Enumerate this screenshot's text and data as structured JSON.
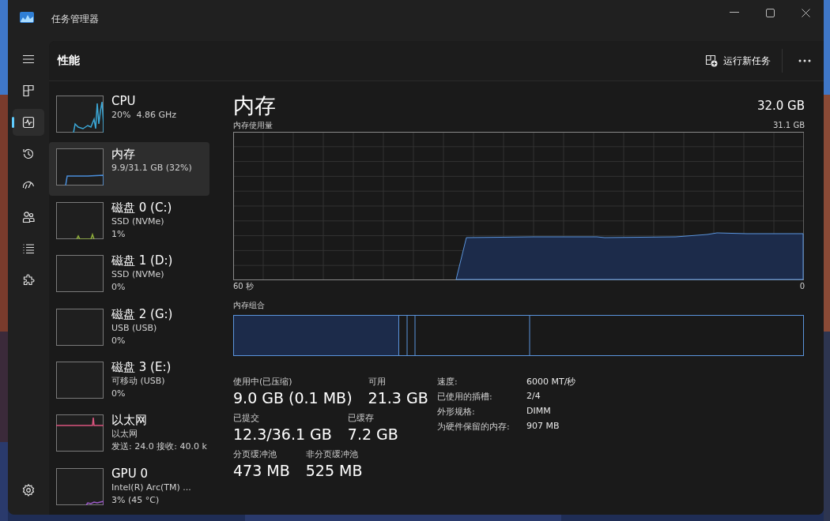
{
  "window": {
    "title": "任务管理器"
  },
  "nav_items": [
    {
      "kind": "menu",
      "selected": false
    },
    {
      "kind": "processes",
      "selected": false
    },
    {
      "kind": "performance",
      "selected": true
    },
    {
      "kind": "history",
      "selected": false
    },
    {
      "kind": "startup",
      "selected": false
    },
    {
      "kind": "users",
      "selected": false
    },
    {
      "kind": "details",
      "selected": false
    },
    {
      "kind": "services",
      "selected": false
    },
    {
      "kind": "settings",
      "selected": false
    }
  ],
  "page": {
    "title": "性能",
    "run_task": "运行新任务"
  },
  "devices": [
    {
      "kind": "cpu",
      "name": "CPU",
      "lines": [
        "20%  4.86 GHz"
      ],
      "color": "#3ba7d6",
      "selected": false
    },
    {
      "kind": "memory",
      "name": "内存",
      "lines": [
        "9.9/31.1 GB (32%)"
      ],
      "color": "#4a8fdc",
      "selected": true
    },
    {
      "kind": "disk_active",
      "name": "磁盘 0 (C:)",
      "lines": [
        "SSD (NVMe)",
        "1%"
      ],
      "color": "#8fae3a",
      "selected": false
    },
    {
      "kind": "disk",
      "name": "磁盘 1 (D:)",
      "lines": [
        "SSD (NVMe)",
        "0%"
      ],
      "selected": false
    },
    {
      "kind": "disk",
      "name": "磁盘 2 (G:)",
      "lines": [
        "USB (USB)",
        "0%"
      ],
      "selected": false
    },
    {
      "kind": "disk",
      "name": "磁盘 3 (E:)",
      "lines": [
        "可移动 (USB)",
        "0%"
      ],
      "selected": false
    },
    {
      "kind": "ethernet",
      "name": "以太网",
      "lines": [
        "以太网",
        "发送: 24.0 接收: 40.0 k"
      ],
      "color": "#d9547e",
      "selected": false
    },
    {
      "kind": "gpu",
      "name": "GPU 0",
      "lines": [
        "Intel(R) Arc(TM) ...",
        "3% (45 °C)"
      ],
      "color": "#9b59c6",
      "selected": false
    }
  ],
  "detail": {
    "title": "内存",
    "capacity": "32.0 GB",
    "usage_label": "内存使用量",
    "usage_max": "31.1 GB",
    "time_start": "60 秒",
    "time_end": "0",
    "composition_label": "内存组合",
    "stats": [
      [
        {
          "label": "使用中(已压缩)",
          "value": "9.0 GB (0.1 MB)"
        },
        {
          "label": "可用",
          "value": "21.3 GB"
        }
      ],
      [
        {
          "label": "已提交",
          "value": "12.3/36.1 GB"
        },
        {
          "label": "已缓存",
          "value": "7.2 GB"
        }
      ],
      [
        {
          "label": "分页缓冲池",
          "value": "473 MB"
        },
        {
          "label": "非分页缓冲池",
          "value": "525 MB"
        }
      ]
    ],
    "specs": [
      {
        "label": "速度:",
        "value": "6000 MT/秒"
      },
      {
        "label": "已使用的插槽:",
        "value": "2/4"
      },
      {
        "label": "外形规格:",
        "value": "DIMM"
      },
      {
        "label": "为硬件保留的内存:",
        "value": "907 MB"
      }
    ]
  }
}
